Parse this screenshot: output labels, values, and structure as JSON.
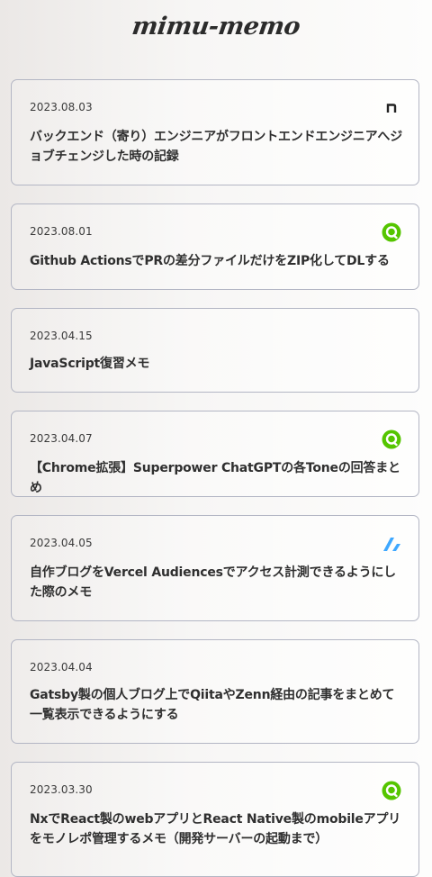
{
  "site": {
    "logo": "mimu-memo"
  },
  "posts": [
    {
      "date": "2023.08.03",
      "title": "バックエンド（寄り）エンジニアがフロントエンドエンジニアへジョブチェンジした時の記録",
      "source_icon": "note-icon"
    },
    {
      "date": "2023.08.01",
      "title": "Github ActionsでPRの差分ファイルだけをZIP化してDLする",
      "source_icon": "qiita-icon"
    },
    {
      "date": "2023.04.15",
      "title": "JavaScript復習メモ",
      "source_icon": ""
    },
    {
      "date": "2023.04.07",
      "title": "【Chrome拡張】Superpower ChatGPTの各Toneの回答まとめ",
      "source_icon": "qiita-icon"
    },
    {
      "date": "2023.04.05",
      "title": "自作ブログをVercel Audiencesでアクセス計測できるようにした際のメモ",
      "source_icon": "zenn-icon"
    },
    {
      "date": "2023.04.04",
      "title": "Gatsby製の個人ブログ上でQiitaやZenn経由の記事をまとめて一覧表示できるようにする",
      "source_icon": ""
    },
    {
      "date": "2023.03.30",
      "title": "NxでReact製のwebアプリとReact Native製のmobileアプリをモノレポ管理するメモ（開発サーバーの起動まで）",
      "source_icon": "qiita-icon"
    }
  ],
  "colors": {
    "qiita": "#55c500",
    "zenn": "#3ea8ff",
    "note": "#222222",
    "card_border": "#b3b6c4"
  }
}
